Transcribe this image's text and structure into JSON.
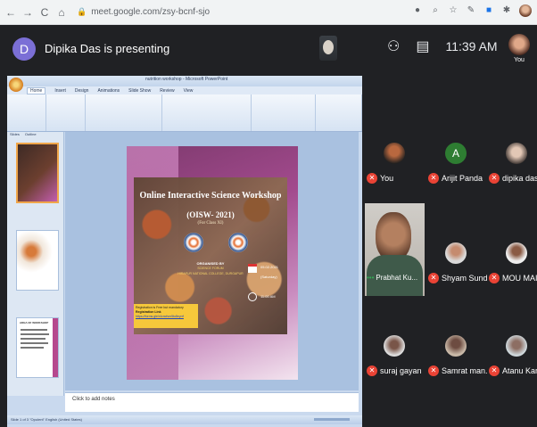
{
  "browser": {
    "back": "←",
    "forward": "→",
    "reload": "C",
    "home": "⌂",
    "url": "meet.google.com/zsy-bcnf-sjo"
  },
  "meet": {
    "presenter_initial": "D",
    "presenter_text": "Dipika Das is presenting",
    "clock": "11:39 AM",
    "you_label": "You"
  },
  "ppt": {
    "window_title": "nutrition workshop - Microsoft PowerPoint",
    "tabs": [
      "Home",
      "Insert",
      "Design",
      "Animations",
      "Slide Show",
      "Review",
      "View"
    ],
    "pane_tabs": [
      "Slides",
      "Outline"
    ],
    "notes_placeholder": "Click to add notes",
    "status": "Slide 1 of 3   \"Opulent\"   English (United States)",
    "thumb3_title": "AREA OF WORKSHOP",
    "slide": {
      "title": "Online Interactive Science Workshop",
      "subtitle": "(OISW- 2021)",
      "class_text": "(For Class XI)",
      "organised": "ORGANISED BY",
      "organiser": "SCIENCE FORUM",
      "college": "HIRAPUR NATIONAL COLLEGE, DURGAPUR",
      "date": "05.02.2021",
      "day": "(Saturday)",
      "time": "11:00 AM",
      "reg_line1": "Registration is Free but mandatory",
      "reg_line2": "Registration Link",
      "reg_link": "https://forms.gle/r4cncfsm5tu8eyrrf"
    }
  },
  "participants": [
    {
      "name": "You",
      "avatar": "photo"
    },
    {
      "name": "Arijit Panda",
      "avatar": "A"
    },
    {
      "name": "dipika das",
      "avatar": "photo"
    },
    {
      "name": "Prabhat Ku...",
      "avatar": "video"
    },
    {
      "name": "Shyam Sund...",
      "avatar": "photo"
    },
    {
      "name": "MOU MAITY",
      "avatar": "photo"
    },
    {
      "name": "suraj gayan",
      "avatar": "photo"
    },
    {
      "name": "Samrat man...",
      "avatar": "photo"
    },
    {
      "name": "Atanu Kara",
      "avatar": "photo"
    }
  ],
  "colors": {
    "muted": "#ea4335",
    "background": "#202124",
    "presenter_avatar": "#7b6fd6"
  }
}
